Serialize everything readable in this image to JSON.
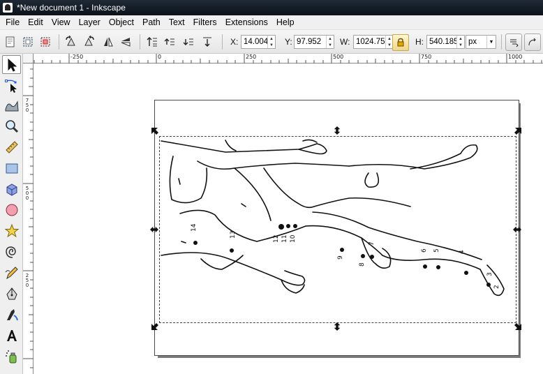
{
  "window": {
    "title": "*New document 1 - Inkscape",
    "app_icon": "inkscape-logo-icon"
  },
  "menu": [
    "File",
    "Edit",
    "View",
    "Layer",
    "Object",
    "Path",
    "Text",
    "Filters",
    "Extensions",
    "Help"
  ],
  "toolbar": {
    "x_label": "X:",
    "x_value": "14.004",
    "y_label": "Y:",
    "y_value": "97.952",
    "w_label": "W:",
    "w_value": "1024.75",
    "h_label": "H:",
    "h_value": "540.185",
    "unit": "px",
    "lock_icon": "lock-icon"
  },
  "ruler": {
    "top_labels": [
      "-250",
      "0",
      "250",
      "500",
      "750",
      "1000"
    ],
    "left_labels": [
      "750",
      "500",
      "250"
    ]
  },
  "tools": [
    "selector-icon",
    "node-editor-icon",
    "tweak-icon",
    "zoom-icon",
    "measure-icon",
    "rectangle-icon",
    "box-3d-icon",
    "ellipse-icon",
    "star-icon",
    "spiral-icon",
    "pencil-icon",
    "pen-icon",
    "calligraphy-icon",
    "text-icon",
    "spray-icon"
  ],
  "figure_labels": [
    "14",
    "13",
    "12",
    "11",
    "10",
    "9",
    "8",
    "7",
    "6",
    "5",
    "4",
    "3",
    "2"
  ]
}
